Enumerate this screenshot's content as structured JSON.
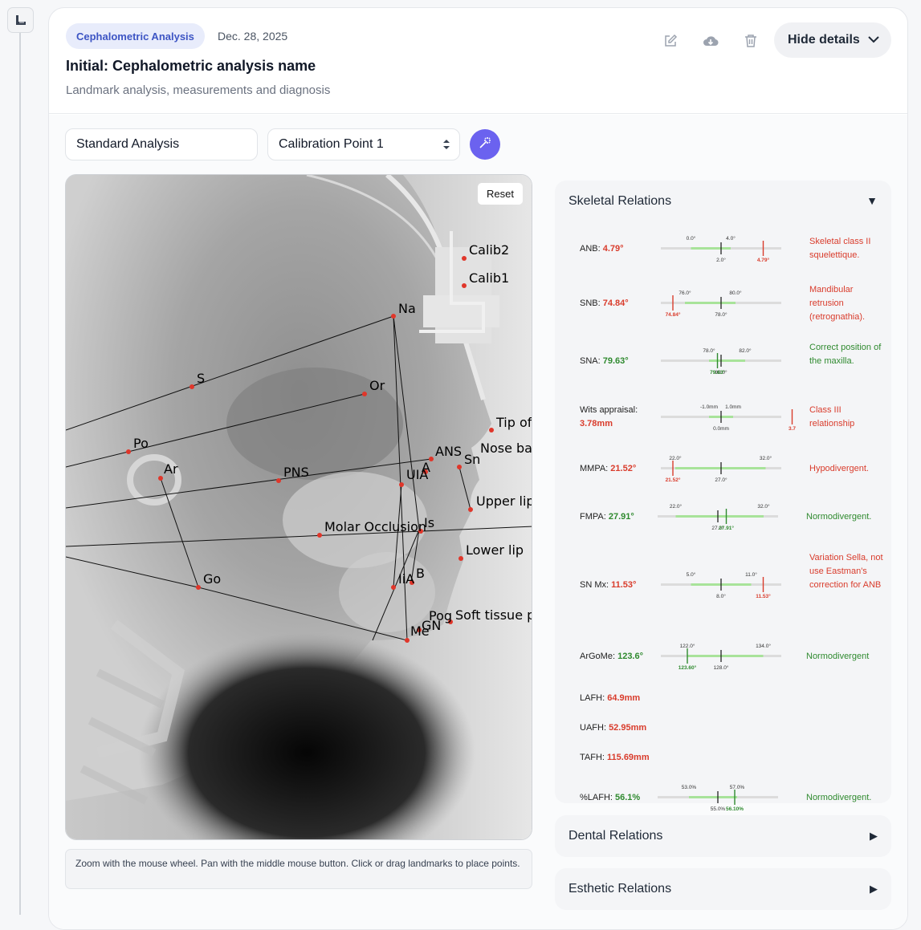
{
  "header": {
    "badge": "Cephalometric Analysis",
    "date": "Dec. 28, 2025",
    "title": "Initial: Cephalometric analysis name",
    "subtitle": "Landmark analysis, measurements and diagnosis",
    "hide_details": "Hide details"
  },
  "controls": {
    "analysis_value": "Standard Analysis",
    "calibration_value": "Calibration Point 1"
  },
  "xray": {
    "reset_label": "Reset",
    "hint": "Zoom with the mouse wheel. Pan with the middle mouse button. Click or drag landmarks to place points.",
    "landmarks": [
      "Calib2",
      "Calib1",
      "Na",
      "S",
      "Or",
      "Po",
      "Ar",
      "PNS",
      "ANS",
      "A",
      "Sn",
      "UIA",
      "Tip of",
      "Nose ba",
      "Upper lip",
      "Molar Occlusion",
      "Is",
      "Lower lip",
      "Go",
      "IiA",
      "B",
      "Pog",
      "GN",
      "Me",
      "Soft tissue p"
    ]
  },
  "skeletal": {
    "title": "Skeletal Relations",
    "toggle": "▼",
    "measurements": [
      {
        "name": "ANB:",
        "value": "4.79°",
        "status": "red",
        "diag": "Skeletal class II squelettique.",
        "min_label": "0.0°",
        "max_label": "4.0°",
        "mean_label": "2.0°",
        "cur_label": "4.79°"
      },
      {
        "name": "SNB:",
        "value": "74.84°",
        "status": "red",
        "diag": "Mandibular retrusion (retrognathia).",
        "min_label": "76.0°",
        "max_label": "80.0°",
        "mean_label": "78.0°",
        "cur_label": "74.84°"
      },
      {
        "name": "SNA:",
        "value": "79.63°",
        "status": "green",
        "diag": "Correct position of the maxilla.",
        "min_label": "78.0°",
        "max_label": "82.0°",
        "mean_label": "80.0°",
        "cur_label": "79.63°"
      },
      {
        "name": "Wits appraisal:",
        "value": "3.78mm",
        "status": "red",
        "diag": "Class III relationship",
        "min_label": "-1.0mm",
        "max_label": "1.0mm",
        "mean_label": "0.0mm",
        "cur_label": "3.7"
      },
      {
        "name": "MMPA:",
        "value": "21.52°",
        "status": "red",
        "diag": "Hypodivergent.",
        "min_label": "22.0°",
        "max_label": "32.0°",
        "mean_label": "27.0°",
        "cur_label": "21.52°"
      },
      {
        "name": "FMPA:",
        "value": "27.91°",
        "status": "green",
        "diag": "Normodivergent.",
        "min_label": "22.0°",
        "max_label": "32.0°",
        "mean_label": "27.0°",
        "cur_label": "27.91°"
      },
      {
        "name": "SN Mx:",
        "value": "11.53°",
        "status": "red",
        "diag": "Variation Sella, not use Eastman's correction for ANB",
        "min_label": "5.0°",
        "max_label": "11.0°",
        "mean_label": "8.0°",
        "cur_label": "11.53°"
      },
      {
        "name": "ArGoMe:",
        "value": "123.6°",
        "status": "green",
        "diag": "Normodivergent",
        "min_label": "122.0°",
        "max_label": "134.0°",
        "mean_label": "128.0°",
        "cur_label": "123.60°"
      },
      {
        "name": "LAFH:",
        "value": "64.9mm",
        "status": "red",
        "diag": ""
      },
      {
        "name": "UAFH:",
        "value": "52.95mm",
        "status": "red",
        "diag": ""
      },
      {
        "name": "TAFH:",
        "value": "115.69mm",
        "status": "red",
        "diag": ""
      },
      {
        "name": "%LAFH:",
        "value": "56.1%",
        "status": "green",
        "diag": "Normodivergent.",
        "min_label": "53.0%",
        "max_label": "57.0%",
        "mean_label": "55.0%",
        "cur_label": "56.10%"
      }
    ]
  },
  "dental": {
    "title": "Dental Relations",
    "toggle": "▶"
  },
  "esthetic": {
    "title": "Esthetic Relations",
    "toggle": "▶"
  },
  "colors": {
    "accent": "#6b62ef",
    "badge_bg": "#e8ecfb",
    "badge_fg": "#3d55c4",
    "red": "#d93c2c",
    "green": "#2f8a2f",
    "range": "#a8e39a"
  }
}
